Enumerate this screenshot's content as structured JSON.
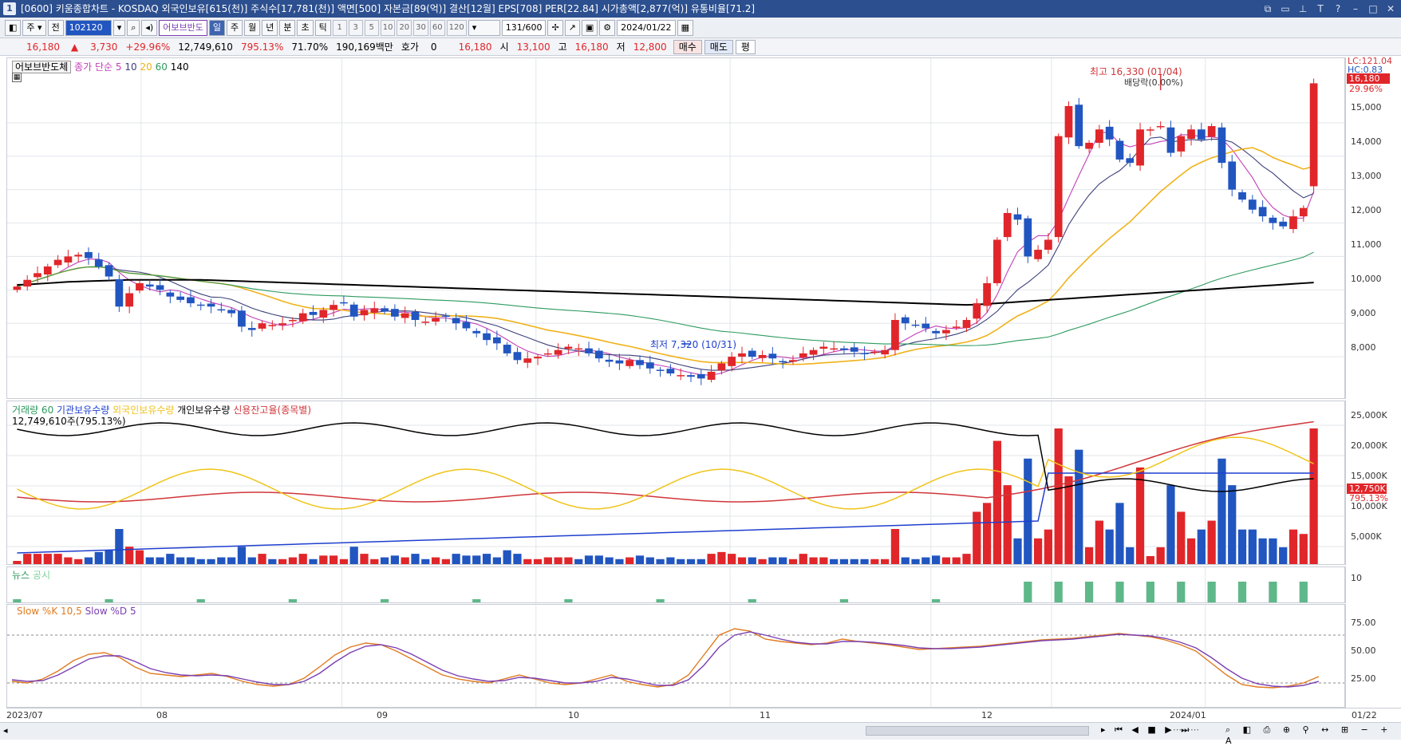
{
  "title": "[0600] 키움종합차트 - KOSDAQ 외국인보유[615(천)] 주식수[17,781(천)] 액면[500] 자본금[89(억)] 결산[12월] EPS[708] PER[22.84] 시가총액[2,877(억)] 유통비율[71.2]",
  "toolbar": {
    "period_select": "주",
    "prev_label": "전",
    "code": "102120",
    "stock_name": "어보브반도",
    "periods": [
      "일",
      "주",
      "월",
      "년",
      "분",
      "초",
      "틱"
    ],
    "intervals": [
      "1",
      "3",
      "5",
      "10",
      "20",
      "30",
      "60",
      "120"
    ],
    "count": "131",
    "count_total": "/600",
    "date": "2024/01/22"
  },
  "quote": {
    "price": "16,180",
    "change": "3,730",
    "change_pct": "+29.96%",
    "volume": "12,749,610",
    "vol_ratio": "795.13%",
    "turnover": "71.70%",
    "amount": "190,169백만",
    "hoga_label": "호가",
    "hoga_value": "0",
    "hoga_price": "16,180",
    "open_label": "시",
    "open": "13,100",
    "high_label": "고",
    "high": "16,180",
    "low_label": "저",
    "low": "12,800",
    "buy_label": "매수",
    "sell_label": "매도",
    "eval_label": "평"
  },
  "price_panel": {
    "stock_label": "어보브반도체",
    "ma_label": "종가 단순",
    "ma_periods": [
      "5",
      "10",
      "20",
      "60",
      "140"
    ],
    "ma_colors": [
      "#c23fb8",
      "#3b3f7a",
      "#f0b21a",
      "#2d9a5e",
      "#000000"
    ],
    "high_annotation": "최고 16,330 (01/04)",
    "dividend_annotation": "배당락(0.00%)",
    "low_annotation": "최저 7,320 (10/31)",
    "lc_label": "LC:121.04",
    "hc_label": "HC:0.83",
    "current_price_tag": "16,180",
    "current_pct_tag": "29.96%",
    "y_ticks": [
      "15,000",
      "14,000",
      "13,000",
      "12,000",
      "11,000",
      "10,000",
      "9,000",
      "8,000"
    ]
  },
  "volume_panel": {
    "legend": [
      {
        "text": "거래량 60",
        "color": "#2d9a5e"
      },
      {
        "text": "기관보유수량",
        "color": "#1f3fcf"
      },
      {
        "text": "외국인보유수량",
        "color": "#f0c419"
      },
      {
        "text": "개인보유수량",
        "color": "#000000"
      },
      {
        "text": "신용잔고율(종목별)",
        "color": "#d0363a"
      }
    ],
    "summary": "12,749,610주(795.13%)",
    "current_tag": "12,750K",
    "current_pct": "795.13%",
    "y_ticks": [
      "25,000K",
      "20,000K",
      "15,000K",
      "10,000K",
      "5,000K"
    ]
  },
  "news_panel": {
    "news_label": "뉴스",
    "disclosure_label": "공시",
    "y_tick": "10"
  },
  "stoch_panel": {
    "label_k": "Slow %K 10,5",
    "label_d": "Slow %D 5",
    "y_ticks": [
      "75.00",
      "50.00",
      "25.00"
    ]
  },
  "x_axis": {
    "labels": [
      "2023/07",
      "08",
      "09",
      "10",
      "11",
      "12",
      "2024/01",
      "01/22"
    ]
  },
  "chart_data": {
    "type": "candlestick",
    "period": "daily",
    "date_range": [
      "2023/07",
      "2024/01/22"
    ],
    "y_range": [
      7000,
      16500
    ],
    "highlights": {
      "high": {
        "value": 16330,
        "date": "01/04"
      },
      "low": {
        "value": 7320,
        "date": "10/31"
      },
      "last": {
        "close": 16180,
        "open": 13100,
        "high": 16180,
        "low": 12800,
        "change_pct": 29.96
      }
    },
    "closes": [
      10100,
      10300,
      10500,
      10700,
      10900,
      11000,
      11050,
      10950,
      10700,
      10400,
      9500,
      9900,
      10200,
      10100,
      10000,
      9800,
      9700,
      9600,
      9550,
      9500,
      9400,
      9300,
      8900,
      8800,
      9000,
      8950,
      9000,
      9100,
      9300,
      9250,
      9400,
      9550,
      9600,
      9200,
      9400,
      9450,
      9350,
      9200,
      9300,
      9100,
      9050,
      9150,
      9200,
      9000,
      8850,
      8700,
      8500,
      8400,
      8100,
      7900,
      7950,
      8000,
      8100,
      8200,
      8300,
      8250,
      8100,
      7950,
      7850,
      7800,
      7900,
      7750,
      7650,
      7600,
      7500,
      7450,
      7400,
      7350,
      7550,
      7800,
      8000,
      8100,
      8000,
      8050,
      7950,
      7850,
      7900,
      8100,
      8200,
      8300,
      8250,
      8200,
      8150,
      8100,
      8150,
      8200,
      9100,
      9000,
      8950,
      8850,
      8700,
      8800,
      8900,
      9100,
      9600,
      10200,
      11500,
      12300,
      12100,
      11000,
      11200,
      11500,
      14600,
      15500,
      14300,
      14400,
      14800,
      14500,
      13900,
      13800,
      14800,
      14800,
      14900,
      14100,
      14600,
      14800,
      14500,
      14900,
      13800,
      13000,
      12700,
      12400,
      12200,
      12000,
      11900,
      12200,
      12450,
      16180
    ],
    "ma140": [
      10150,
      10160,
      10180,
      10200,
      10220,
      10240,
      10250,
      10260,
      10270,
      10280,
      10290,
      10300,
      10300,
      10300,
      10300,
      10300,
      10300,
      10300,
      10300,
      10290,
      10280,
      10270,
      10260,
      10250,
      10240,
      10230,
      10220,
      10210,
      10200,
      10190,
      10180,
      10170,
      10160,
      10150,
      10140,
      10130,
      10120,
      10110,
      10100,
      10090,
      10080,
      10070,
      10060,
      10050,
      10040,
      10030,
      10020,
      10010,
      10000,
      9990,
      9980,
      9970,
      9960,
      9950,
      9940,
      9930,
      9920,
      9910,
      9900,
      9890,
      9880,
      9870,
      9860,
      9850,
      9840,
      9830,
      9820,
      9810,
      9800,
      9790,
      9780,
      9770,
      9760,
      9750,
      9740,
      9730,
      9720,
      9710,
      9700,
      9690,
      9680,
      9670,
      9660,
      9650,
      9640,
      9630,
      9620,
      9610,
      9600,
      9590,
      9580,
      9570,
      9560,
      9550,
      9560,
      9580,
      9600,
      9620,
      9640,
      9660,
      9680,
      9700,
      9720,
      9740,
      9760,
      9780,
      9800,
      9820,
      9840,
      9860,
      9880,
      9900,
      9920,
      9940,
      9960,
      9980,
      10000,
      10020,
      10040,
      10060,
      10080,
      10100,
      10120,
      10140,
      10160,
      10180,
      10200,
      10220
    ],
    "stoch_k": [
      22,
      20,
      25,
      35,
      48,
      56,
      58,
      52,
      40,
      32,
      30,
      28,
      30,
      32,
      28,
      22,
      18,
      16,
      18,
      26,
      40,
      55,
      65,
      70,
      68,
      60,
      50,
      40,
      30,
      25,
      22,
      20,
      25,
      30,
      25,
      20,
      18,
      20,
      25,
      30,
      22,
      18,
      15,
      18,
      30,
      55,
      80,
      88,
      85,
      75,
      72,
      70,
      68,
      70,
      75,
      72,
      70,
      68,
      65,
      62,
      63,
      64,
      65,
      66,
      68,
      70,
      72,
      74,
      75,
      76,
      78,
      80,
      82,
      80,
      78,
      74,
      68,
      60,
      45,
      30,
      18,
      15,
      14,
      16,
      20,
      28
    ],
    "stoch_d": [
      24,
      22,
      23,
      30,
      40,
      50,
      54,
      54,
      47,
      38,
      33,
      30,
      29,
      30,
      29,
      25,
      21,
      18,
      18,
      22,
      32,
      46,
      58,
      66,
      68,
      64,
      56,
      46,
      36,
      29,
      25,
      22,
      23,
      27,
      26,
      23,
      20,
      20,
      22,
      27,
      25,
      21,
      17,
      17,
      24,
      42,
      65,
      80,
      84,
      80,
      75,
      71,
      69,
      69,
      72,
      72,
      71,
      69,
      67,
      64,
      63,
      63,
      64,
      65,
      67,
      69,
      71,
      73,
      74,
      75,
      77,
      79,
      81,
      80,
      79,
      76,
      71,
      64,
      52,
      38,
      26,
      19,
      16,
      15,
      17,
      22
    ]
  }
}
